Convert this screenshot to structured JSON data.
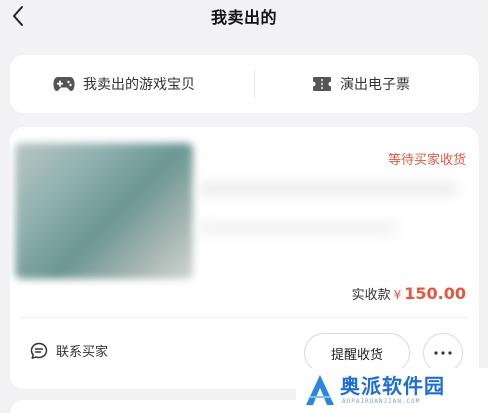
{
  "header": {
    "title": "我卖出的"
  },
  "tabs": [
    {
      "label": "我卖出的游戏宝贝",
      "icon": "gamepad-icon"
    },
    {
      "label": "演出电子票",
      "icon": "ticket-icon"
    }
  ],
  "order": {
    "status": "等待买家收货",
    "amount_label": "实收款",
    "currency": "¥",
    "amount": "150.00",
    "contact_label": "联系买家",
    "remind_label": "提醒收货",
    "more_icon": "more-icon"
  },
  "watermark": {
    "brand": "奥派软件园",
    "url": "AOPAIRUANJIAN.COM"
  },
  "colors": {
    "accent": "#e8563f",
    "background": "#f2f2f4",
    "watermark": "#1f6fd1"
  }
}
